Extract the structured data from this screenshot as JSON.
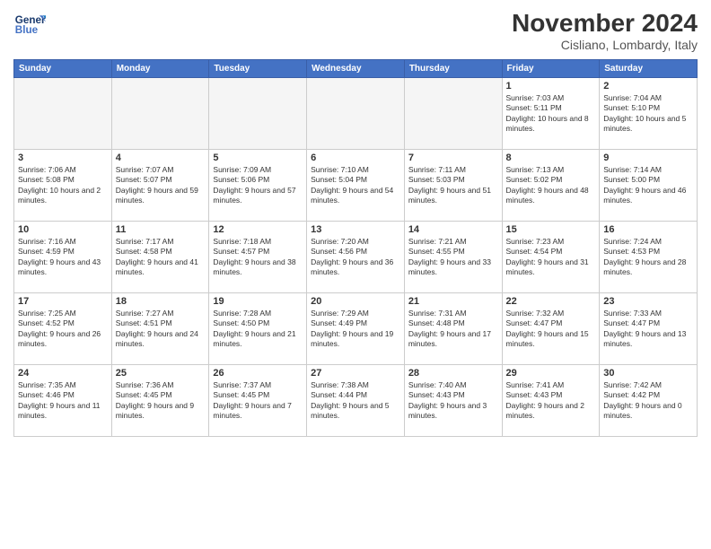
{
  "header": {
    "logo": {
      "line1": "General",
      "line2": "Blue"
    },
    "title": "November 2024",
    "location": "Cisliano, Lombardy, Italy"
  },
  "weekdays": [
    "Sunday",
    "Monday",
    "Tuesday",
    "Wednesday",
    "Thursday",
    "Friday",
    "Saturday"
  ],
  "weeks": [
    [
      {
        "day": "",
        "info": "",
        "empty": true
      },
      {
        "day": "",
        "info": "",
        "empty": true
      },
      {
        "day": "",
        "info": "",
        "empty": true
      },
      {
        "day": "",
        "info": "",
        "empty": true
      },
      {
        "day": "",
        "info": "",
        "empty": true
      },
      {
        "day": "1",
        "info": "Sunrise: 7:03 AM\nSunset: 5:11 PM\nDaylight: 10 hours and 8 minutes."
      },
      {
        "day": "2",
        "info": "Sunrise: 7:04 AM\nSunset: 5:10 PM\nDaylight: 10 hours and 5 minutes."
      }
    ],
    [
      {
        "day": "3",
        "info": "Sunrise: 7:06 AM\nSunset: 5:08 PM\nDaylight: 10 hours and 2 minutes."
      },
      {
        "day": "4",
        "info": "Sunrise: 7:07 AM\nSunset: 5:07 PM\nDaylight: 9 hours and 59 minutes."
      },
      {
        "day": "5",
        "info": "Sunrise: 7:09 AM\nSunset: 5:06 PM\nDaylight: 9 hours and 57 minutes."
      },
      {
        "day": "6",
        "info": "Sunrise: 7:10 AM\nSunset: 5:04 PM\nDaylight: 9 hours and 54 minutes."
      },
      {
        "day": "7",
        "info": "Sunrise: 7:11 AM\nSunset: 5:03 PM\nDaylight: 9 hours and 51 minutes."
      },
      {
        "day": "8",
        "info": "Sunrise: 7:13 AM\nSunset: 5:02 PM\nDaylight: 9 hours and 48 minutes."
      },
      {
        "day": "9",
        "info": "Sunrise: 7:14 AM\nSunset: 5:00 PM\nDaylight: 9 hours and 46 minutes."
      }
    ],
    [
      {
        "day": "10",
        "info": "Sunrise: 7:16 AM\nSunset: 4:59 PM\nDaylight: 9 hours and 43 minutes."
      },
      {
        "day": "11",
        "info": "Sunrise: 7:17 AM\nSunset: 4:58 PM\nDaylight: 9 hours and 41 minutes."
      },
      {
        "day": "12",
        "info": "Sunrise: 7:18 AM\nSunset: 4:57 PM\nDaylight: 9 hours and 38 minutes."
      },
      {
        "day": "13",
        "info": "Sunrise: 7:20 AM\nSunset: 4:56 PM\nDaylight: 9 hours and 36 minutes."
      },
      {
        "day": "14",
        "info": "Sunrise: 7:21 AM\nSunset: 4:55 PM\nDaylight: 9 hours and 33 minutes."
      },
      {
        "day": "15",
        "info": "Sunrise: 7:23 AM\nSunset: 4:54 PM\nDaylight: 9 hours and 31 minutes."
      },
      {
        "day": "16",
        "info": "Sunrise: 7:24 AM\nSunset: 4:53 PM\nDaylight: 9 hours and 28 minutes."
      }
    ],
    [
      {
        "day": "17",
        "info": "Sunrise: 7:25 AM\nSunset: 4:52 PM\nDaylight: 9 hours and 26 minutes."
      },
      {
        "day": "18",
        "info": "Sunrise: 7:27 AM\nSunset: 4:51 PM\nDaylight: 9 hours and 24 minutes."
      },
      {
        "day": "19",
        "info": "Sunrise: 7:28 AM\nSunset: 4:50 PM\nDaylight: 9 hours and 21 minutes."
      },
      {
        "day": "20",
        "info": "Sunrise: 7:29 AM\nSunset: 4:49 PM\nDaylight: 9 hours and 19 minutes."
      },
      {
        "day": "21",
        "info": "Sunrise: 7:31 AM\nSunset: 4:48 PM\nDaylight: 9 hours and 17 minutes."
      },
      {
        "day": "22",
        "info": "Sunrise: 7:32 AM\nSunset: 4:47 PM\nDaylight: 9 hours and 15 minutes."
      },
      {
        "day": "23",
        "info": "Sunrise: 7:33 AM\nSunset: 4:47 PM\nDaylight: 9 hours and 13 minutes."
      }
    ],
    [
      {
        "day": "24",
        "info": "Sunrise: 7:35 AM\nSunset: 4:46 PM\nDaylight: 9 hours and 11 minutes."
      },
      {
        "day": "25",
        "info": "Sunrise: 7:36 AM\nSunset: 4:45 PM\nDaylight: 9 hours and 9 minutes."
      },
      {
        "day": "26",
        "info": "Sunrise: 7:37 AM\nSunset: 4:45 PM\nDaylight: 9 hours and 7 minutes."
      },
      {
        "day": "27",
        "info": "Sunrise: 7:38 AM\nSunset: 4:44 PM\nDaylight: 9 hours and 5 minutes."
      },
      {
        "day": "28",
        "info": "Sunrise: 7:40 AM\nSunset: 4:43 PM\nDaylight: 9 hours and 3 minutes."
      },
      {
        "day": "29",
        "info": "Sunrise: 7:41 AM\nSunset: 4:43 PM\nDaylight: 9 hours and 2 minutes."
      },
      {
        "day": "30",
        "info": "Sunrise: 7:42 AM\nSunset: 4:42 PM\nDaylight: 9 hours and 0 minutes."
      }
    ]
  ]
}
